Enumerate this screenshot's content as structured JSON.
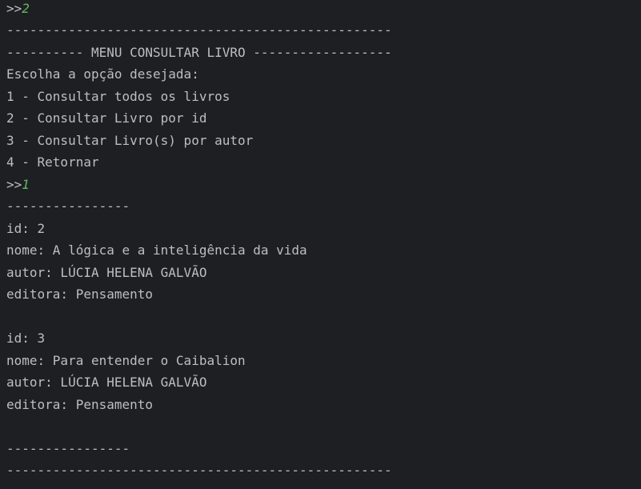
{
  "console": {
    "prompt_symbol": ">>",
    "colors": {
      "background": "#1e1f22",
      "text": "#bcbec4",
      "user_input": "#5fb865"
    },
    "lines": [
      {
        "prompt": ">>",
        "input": "2"
      },
      {
        "text": "--------------------------------------------------"
      },
      {
        "text": "---------- MENU CONSULTAR LIVRO ------------------"
      },
      {
        "text": "Escolha a opção desejada:"
      },
      {
        "text": "1 - Consultar todos os livros"
      },
      {
        "text": "2 - Consultar Livro por id"
      },
      {
        "text": "3 - Consultar Livro(s) por autor"
      },
      {
        "text": "4 - Retornar"
      },
      {
        "prompt": ">>",
        "input": "1"
      },
      {
        "text": "----------------"
      },
      {
        "text": "id: 2"
      },
      {
        "text": "nome: A lógica e a inteligência da vida"
      },
      {
        "text": "autor: LÚCIA HELENA GALVÃO"
      },
      {
        "text": "editora: Pensamento"
      },
      {
        "text": ""
      },
      {
        "text": "id: 3"
      },
      {
        "text": "nome: Para entender o Caibalion"
      },
      {
        "text": "autor: LÚCIA HELENA GALVÃO"
      },
      {
        "text": "editora: Pensamento"
      },
      {
        "text": ""
      },
      {
        "text": "----------------"
      },
      {
        "text": "--------------------------------------------------"
      }
    ]
  }
}
